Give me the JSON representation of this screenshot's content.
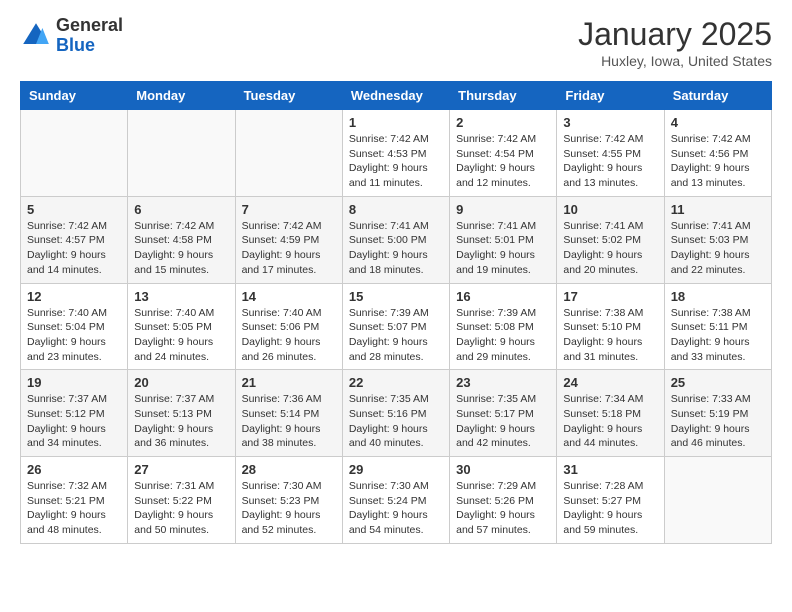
{
  "header": {
    "logo_line1": "General",
    "logo_line2": "Blue",
    "month": "January 2025",
    "location": "Huxley, Iowa, United States"
  },
  "weekdays": [
    "Sunday",
    "Monday",
    "Tuesday",
    "Wednesday",
    "Thursday",
    "Friday",
    "Saturday"
  ],
  "weeks": [
    [
      {
        "day": "",
        "info": ""
      },
      {
        "day": "",
        "info": ""
      },
      {
        "day": "",
        "info": ""
      },
      {
        "day": "1",
        "info": "Sunrise: 7:42 AM\nSunset: 4:53 PM\nDaylight: 9 hours\nand 11 minutes."
      },
      {
        "day": "2",
        "info": "Sunrise: 7:42 AM\nSunset: 4:54 PM\nDaylight: 9 hours\nand 12 minutes."
      },
      {
        "day": "3",
        "info": "Sunrise: 7:42 AM\nSunset: 4:55 PM\nDaylight: 9 hours\nand 13 minutes."
      },
      {
        "day": "4",
        "info": "Sunrise: 7:42 AM\nSunset: 4:56 PM\nDaylight: 9 hours\nand 13 minutes."
      }
    ],
    [
      {
        "day": "5",
        "info": "Sunrise: 7:42 AM\nSunset: 4:57 PM\nDaylight: 9 hours\nand 14 minutes."
      },
      {
        "day": "6",
        "info": "Sunrise: 7:42 AM\nSunset: 4:58 PM\nDaylight: 9 hours\nand 15 minutes."
      },
      {
        "day": "7",
        "info": "Sunrise: 7:42 AM\nSunset: 4:59 PM\nDaylight: 9 hours\nand 17 minutes."
      },
      {
        "day": "8",
        "info": "Sunrise: 7:41 AM\nSunset: 5:00 PM\nDaylight: 9 hours\nand 18 minutes."
      },
      {
        "day": "9",
        "info": "Sunrise: 7:41 AM\nSunset: 5:01 PM\nDaylight: 9 hours\nand 19 minutes."
      },
      {
        "day": "10",
        "info": "Sunrise: 7:41 AM\nSunset: 5:02 PM\nDaylight: 9 hours\nand 20 minutes."
      },
      {
        "day": "11",
        "info": "Sunrise: 7:41 AM\nSunset: 5:03 PM\nDaylight: 9 hours\nand 22 minutes."
      }
    ],
    [
      {
        "day": "12",
        "info": "Sunrise: 7:40 AM\nSunset: 5:04 PM\nDaylight: 9 hours\nand 23 minutes."
      },
      {
        "day": "13",
        "info": "Sunrise: 7:40 AM\nSunset: 5:05 PM\nDaylight: 9 hours\nand 24 minutes."
      },
      {
        "day": "14",
        "info": "Sunrise: 7:40 AM\nSunset: 5:06 PM\nDaylight: 9 hours\nand 26 minutes."
      },
      {
        "day": "15",
        "info": "Sunrise: 7:39 AM\nSunset: 5:07 PM\nDaylight: 9 hours\nand 28 minutes."
      },
      {
        "day": "16",
        "info": "Sunrise: 7:39 AM\nSunset: 5:08 PM\nDaylight: 9 hours\nand 29 minutes."
      },
      {
        "day": "17",
        "info": "Sunrise: 7:38 AM\nSunset: 5:10 PM\nDaylight: 9 hours\nand 31 minutes."
      },
      {
        "day": "18",
        "info": "Sunrise: 7:38 AM\nSunset: 5:11 PM\nDaylight: 9 hours\nand 33 minutes."
      }
    ],
    [
      {
        "day": "19",
        "info": "Sunrise: 7:37 AM\nSunset: 5:12 PM\nDaylight: 9 hours\nand 34 minutes."
      },
      {
        "day": "20",
        "info": "Sunrise: 7:37 AM\nSunset: 5:13 PM\nDaylight: 9 hours\nand 36 minutes."
      },
      {
        "day": "21",
        "info": "Sunrise: 7:36 AM\nSunset: 5:14 PM\nDaylight: 9 hours\nand 38 minutes."
      },
      {
        "day": "22",
        "info": "Sunrise: 7:35 AM\nSunset: 5:16 PM\nDaylight: 9 hours\nand 40 minutes."
      },
      {
        "day": "23",
        "info": "Sunrise: 7:35 AM\nSunset: 5:17 PM\nDaylight: 9 hours\nand 42 minutes."
      },
      {
        "day": "24",
        "info": "Sunrise: 7:34 AM\nSunset: 5:18 PM\nDaylight: 9 hours\nand 44 minutes."
      },
      {
        "day": "25",
        "info": "Sunrise: 7:33 AM\nSunset: 5:19 PM\nDaylight: 9 hours\nand 46 minutes."
      }
    ],
    [
      {
        "day": "26",
        "info": "Sunrise: 7:32 AM\nSunset: 5:21 PM\nDaylight: 9 hours\nand 48 minutes."
      },
      {
        "day": "27",
        "info": "Sunrise: 7:31 AM\nSunset: 5:22 PM\nDaylight: 9 hours\nand 50 minutes."
      },
      {
        "day": "28",
        "info": "Sunrise: 7:30 AM\nSunset: 5:23 PM\nDaylight: 9 hours\nand 52 minutes."
      },
      {
        "day": "29",
        "info": "Sunrise: 7:30 AM\nSunset: 5:24 PM\nDaylight: 9 hours\nand 54 minutes."
      },
      {
        "day": "30",
        "info": "Sunrise: 7:29 AM\nSunset: 5:26 PM\nDaylight: 9 hours\nand 57 minutes."
      },
      {
        "day": "31",
        "info": "Sunrise: 7:28 AM\nSunset: 5:27 PM\nDaylight: 9 hours\nand 59 minutes."
      },
      {
        "day": "",
        "info": ""
      }
    ]
  ]
}
